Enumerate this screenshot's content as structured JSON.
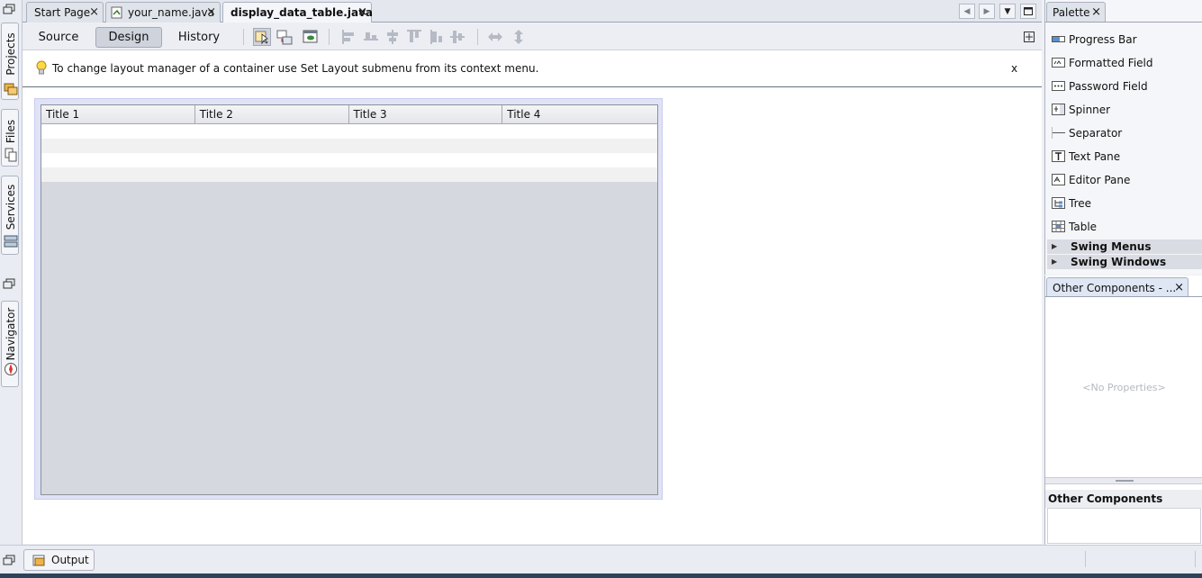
{
  "left_strip": {
    "tabs": [
      {
        "label": "Projects",
        "icon": "projects-icon"
      },
      {
        "label": "Files",
        "icon": "files-icon"
      },
      {
        "label": "Services",
        "icon": "services-icon"
      },
      {
        "label": "Navigator",
        "icon": "navigator-icon"
      }
    ]
  },
  "editor_tabs": [
    {
      "label": "Start Page",
      "close": "×"
    },
    {
      "label": "your_name.java",
      "close": "×"
    },
    {
      "label": "display_data_table.java",
      "close": "×"
    }
  ],
  "toolbar": {
    "source": "Source",
    "design": "Design",
    "history": "History",
    "icons": [
      "selection-mode-icon",
      "connection-mode-icon",
      "preview-design-icon",
      "align-left-icon",
      "align-right-icon",
      "center-horizontally-icon",
      "align-top-icon",
      "align-bottom-icon",
      "center-vertically-icon",
      "resize-horizontal-icon",
      "resize-vertical-icon"
    ]
  },
  "hint": {
    "icon": "lightbulb-icon",
    "text": "To change layout manager of a container use Set Layout submenu from its context menu.",
    "close": "x"
  },
  "table": {
    "columns": [
      "Title 1",
      "Title 2",
      "Title 3",
      "Title 4"
    ],
    "rows": 4
  },
  "palette": {
    "tab_label": "Palette",
    "tab_close": "×",
    "items": [
      {
        "label": "Progress Bar",
        "icon": "progress-bar-icon"
      },
      {
        "label": "Formatted Field",
        "icon": "formatted-field-icon"
      },
      {
        "label": "Password Field",
        "icon": "password-field-icon"
      },
      {
        "label": "Spinner",
        "icon": "spinner-icon"
      },
      {
        "label": "Separator",
        "icon": "separator-icon"
      },
      {
        "label": "Text Pane",
        "icon": "text-pane-icon"
      },
      {
        "label": "Editor Pane",
        "icon": "editor-pane-icon"
      },
      {
        "label": "Tree",
        "icon": "tree-icon"
      },
      {
        "label": "Table",
        "icon": "table-icon"
      }
    ],
    "categories": [
      "Swing Menus",
      "Swing Windows"
    ]
  },
  "properties": {
    "tab_label": "Other Components - ...",
    "tab_close": "×",
    "empty_text": "<No Properties>",
    "section_title": "Other Components"
  },
  "bottom": {
    "output_label": "Output"
  },
  "colors": {
    "canvas_bg": "#ffffff",
    "table_frame": "#e0e2f5",
    "table_body": "#d5d8de",
    "active_tab": "#f4f6fa"
  }
}
